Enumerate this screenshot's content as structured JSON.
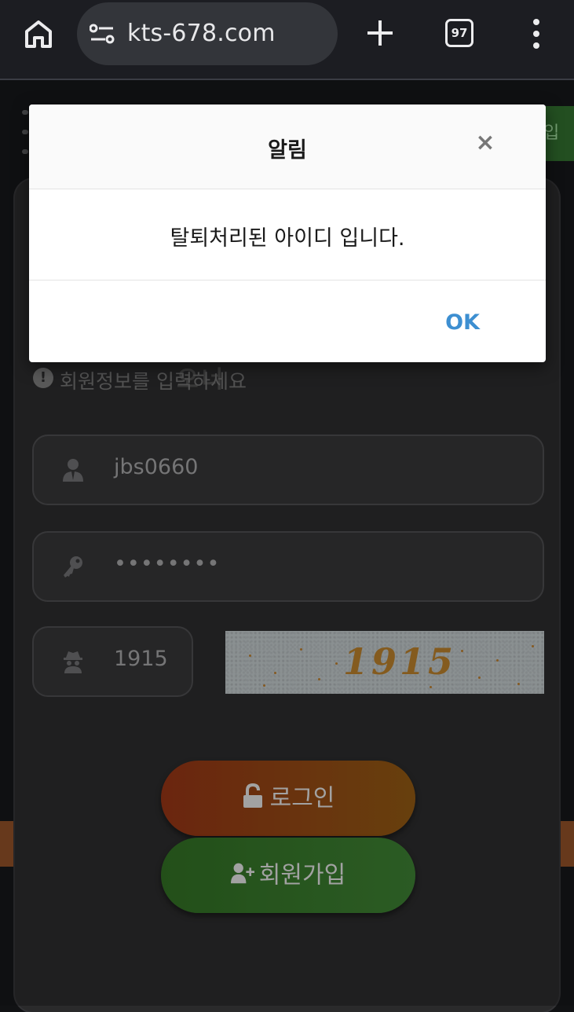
{
  "browser": {
    "url": "kts-678.com",
    "tab_count": "97",
    "icons": [
      "home-icon",
      "site-info-icon",
      "new-tab-icon",
      "tab-switcher-icon",
      "more-menu-icon"
    ]
  },
  "page": {
    "top_join_label": "입",
    "logo_text": "오너",
    "info_text": "회원정보를 입력하세요",
    "fields": {
      "username": "jbs0660",
      "password": "••••••••",
      "captcha_input": "1915"
    },
    "captcha_image_text": "1915",
    "login_label": "로그인",
    "join_label": "회원가입",
    "colors": {
      "login_start": "#8f3214",
      "login_end": "#8a5512",
      "join": "#36742a"
    }
  },
  "dialog": {
    "title": "알림",
    "close_symbol": "×",
    "message": "탈퇴처리된 아이디 입니다.",
    "ok_label": "OK",
    "ok_color": "#3d8fd1"
  }
}
